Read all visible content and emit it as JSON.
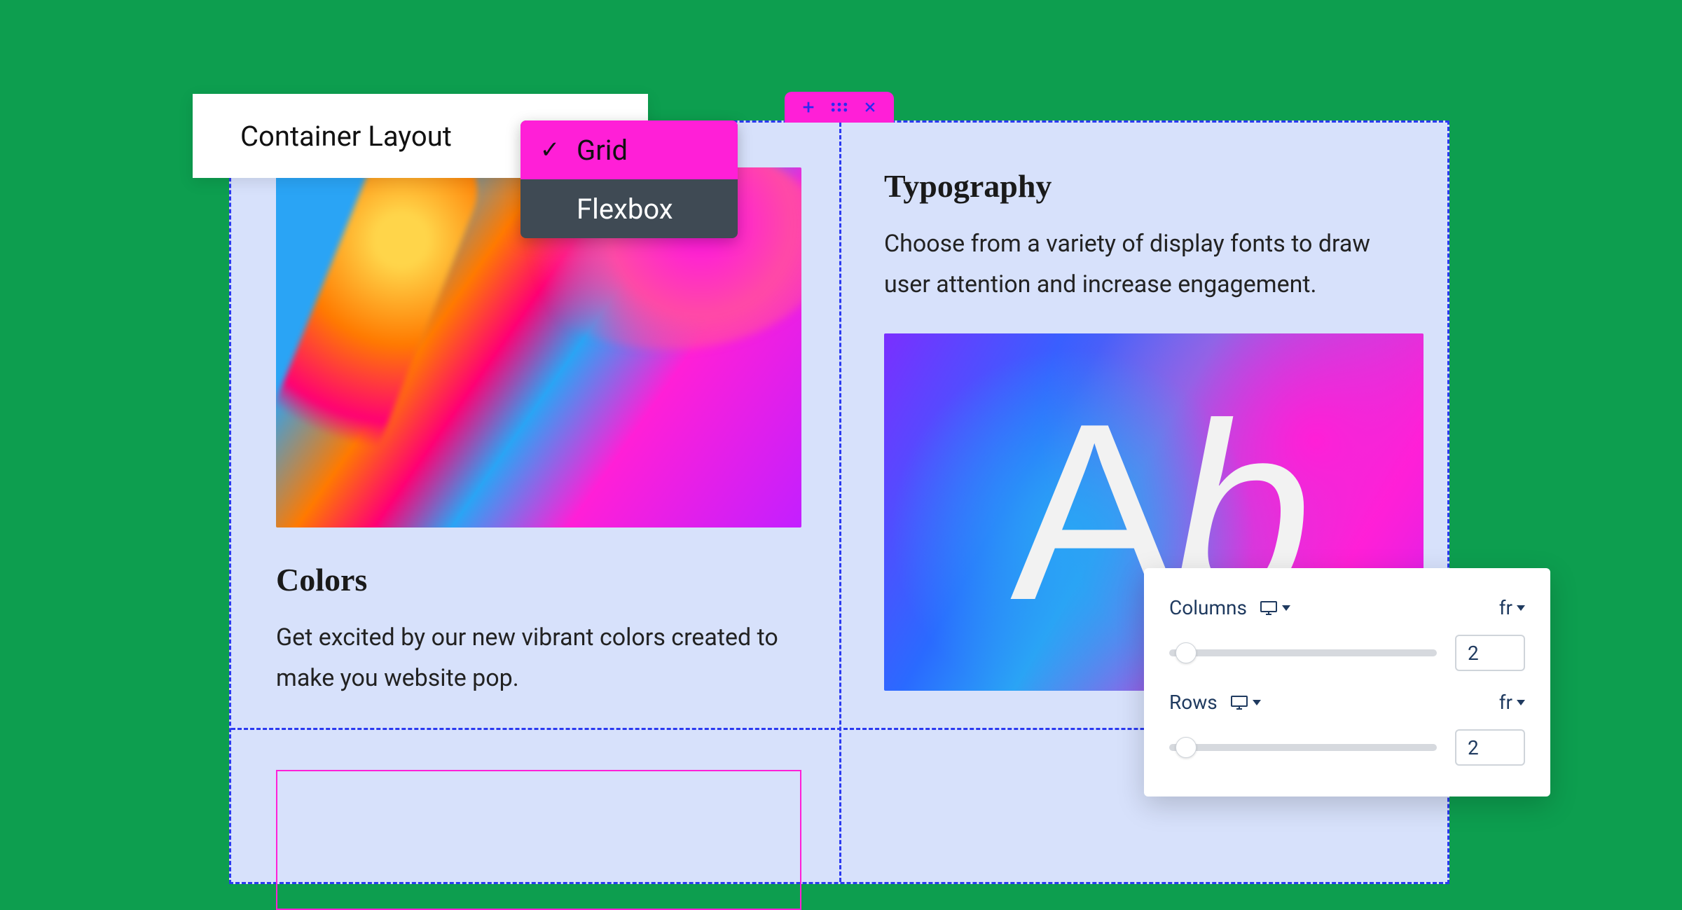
{
  "layout_label": "Container Layout",
  "layout_options": {
    "grid": "Grid",
    "flexbox": "Flexbox",
    "selected": "grid"
  },
  "cells": {
    "colors_title": "Colors",
    "colors_body": "Get excited by our new vibrant colors created to make you website pop.",
    "typography_title": "Typography",
    "typography_body": "Choose from a variety of display fonts to draw user attention and increase engagement.",
    "ab_sample_a": "A",
    "ab_sample_b": "b"
  },
  "grid_panel": {
    "columns_label": "Columns",
    "rows_label": "Rows",
    "unit": "fr",
    "columns_value": "2",
    "rows_value": "2"
  },
  "colors": {
    "page_bg": "#0d9e4f",
    "canvas_bg": "#d7e1fb",
    "selection_pink": "#ff1fd7",
    "dashed_blue": "#2b3af0",
    "panel_text": "#1f3a5f"
  }
}
